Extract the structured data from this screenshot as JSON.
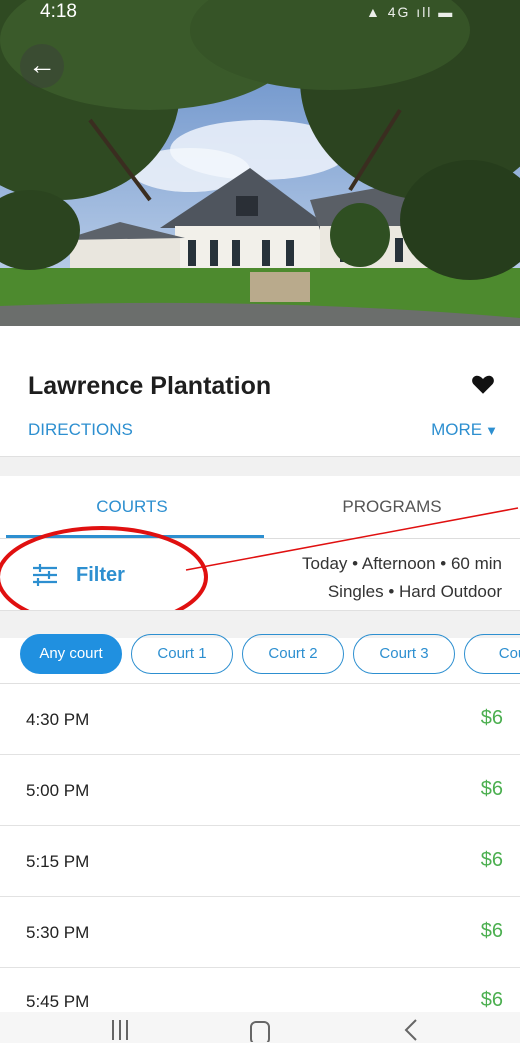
{
  "status_bar": {
    "time": "4:18",
    "icons": "▲ 4G ıll ▬"
  },
  "hero": {
    "back_icon": "arrow-left-icon"
  },
  "venue": {
    "name": "Lawrence Plantation",
    "favorite_icon": "heart-icon",
    "directions_label": "DIRECTIONS",
    "more_label": "MORE",
    "more_icon": "chevron-down-icon"
  },
  "tabs": [
    {
      "label": "COURTS",
      "active": true
    },
    {
      "label": "PROGRAMS",
      "active": false
    }
  ],
  "filter": {
    "label": "Filter",
    "icon": "sliders-icon",
    "summary_line1": "Today • Afternoon • 60 min",
    "summary_line2": "Singles • Hard Outdoor"
  },
  "chips": [
    {
      "label": "Any court",
      "active": true
    },
    {
      "label": "Court 1",
      "active": false
    },
    {
      "label": "Court 2",
      "active": false
    },
    {
      "label": "Court 3",
      "active": false
    },
    {
      "label": "Cour",
      "active": false
    }
  ],
  "slots": [
    {
      "time": "4:30 PM",
      "price": "$6"
    },
    {
      "time": "5:00 PM",
      "price": "$6"
    },
    {
      "time": "5:15 PM",
      "price": "$6"
    },
    {
      "time": "5:30 PM",
      "price": "$6"
    },
    {
      "time": "5:45 PM",
      "price": "$6"
    }
  ],
  "navbar": {
    "recent_icon": "recent-apps-icon",
    "home_icon": "home-icon",
    "back_icon": "back-icon"
  },
  "colors": {
    "accent": "#2d8fd0",
    "price": "#4caf50",
    "annotation": "#e01010"
  }
}
